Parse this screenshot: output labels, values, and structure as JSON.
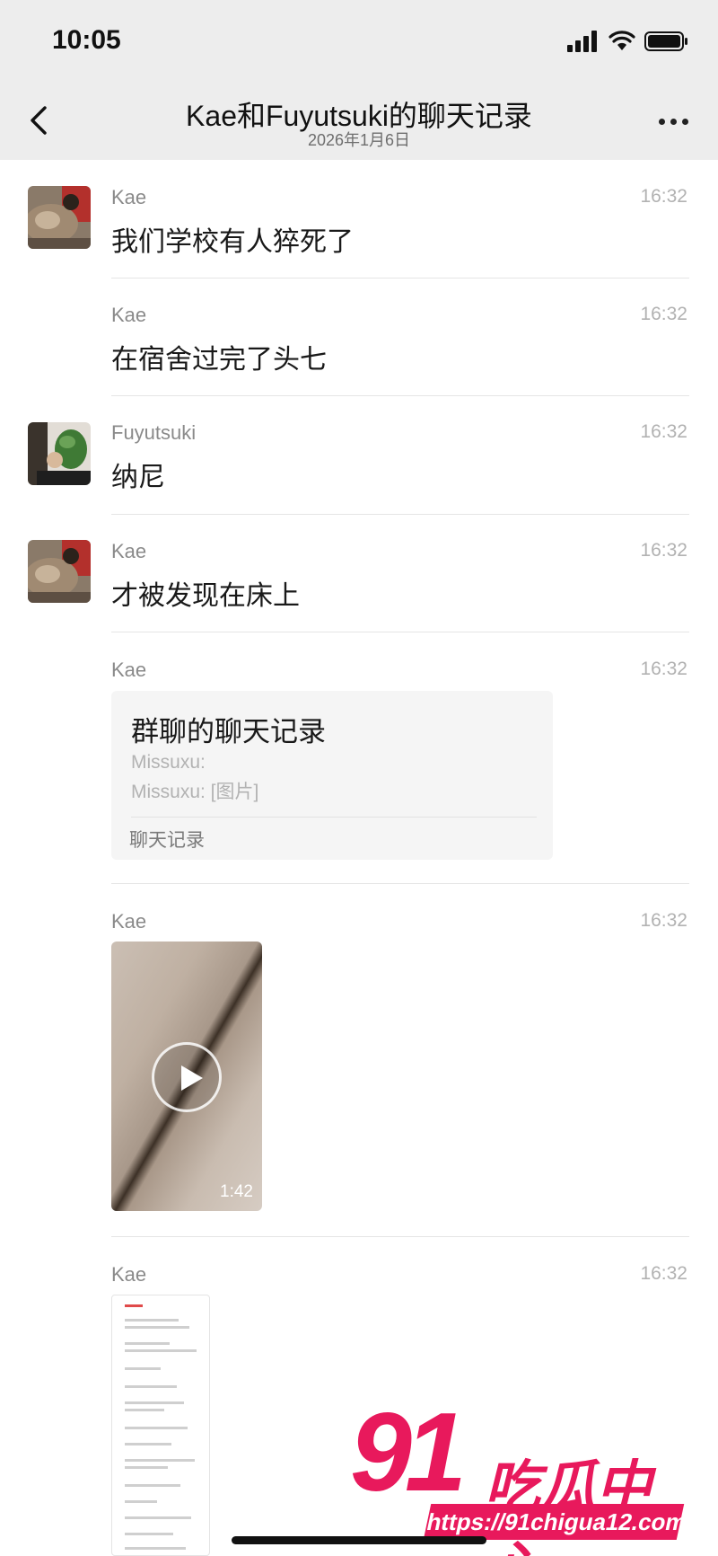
{
  "status_bar": {
    "time": "10:05"
  },
  "header": {
    "title": "Kae和Fuyutsuki的聊天记录",
    "date": "2026年1月6日"
  },
  "messages": [
    {
      "sender": "Kae",
      "time": "16:32",
      "text": "我们学校有人猝死了",
      "avatar": "kae"
    },
    {
      "sender": "Kae",
      "time": "16:32",
      "text": "在宿舍过完了头七"
    },
    {
      "sender": "Fuyutsuki",
      "time": "16:32",
      "text": "纳尼",
      "avatar": "fuyutsuki"
    },
    {
      "sender": "Kae",
      "time": "16:32",
      "text": "才被发现在床上",
      "avatar": "kae"
    },
    {
      "sender": "Kae",
      "time": "16:32",
      "type": "chat-record",
      "card": {
        "title": "群聊的聊天记录",
        "lines": [
          "Missuxu:",
          "Missuxu: [图片]"
        ],
        "footer": "聊天记录"
      }
    },
    {
      "sender": "Kae",
      "time": "16:32",
      "type": "video",
      "duration": "1:42"
    },
    {
      "sender": "Kae",
      "time": "16:32",
      "type": "image"
    }
  ],
  "watermark": {
    "number": "91",
    "name": "吃瓜中心",
    "url": "https://91chigua12.com"
  },
  "colors": {
    "header_bg": "#ededed",
    "watermark": "#e8195c"
  }
}
